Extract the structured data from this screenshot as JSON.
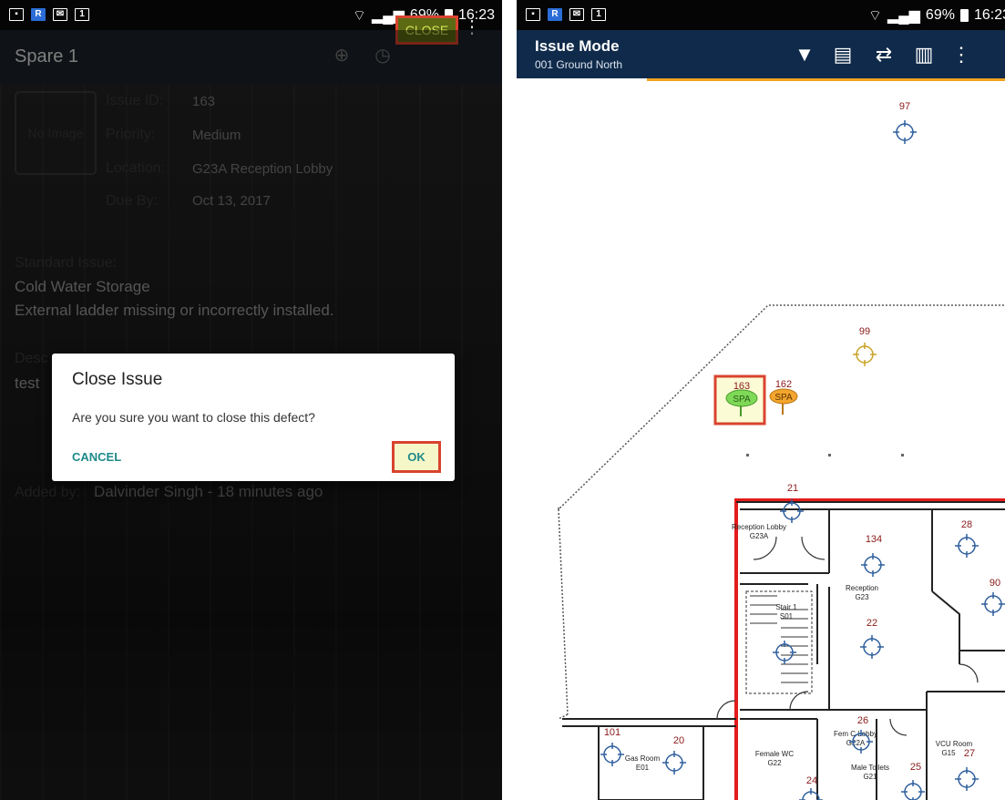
{
  "left": {
    "status": {
      "percent": "69%",
      "time": "16:23"
    },
    "appbar": {
      "title": "Spare 1",
      "close_label": "CLOSE"
    },
    "no_image": "No Image",
    "fields": [
      {
        "label": "Issue ID:",
        "value": "163"
      },
      {
        "label": "Priority:",
        "value": "Medium"
      },
      {
        "label": "Location:",
        "value": "G23A Reception Lobby"
      },
      {
        "label": "Due By:",
        "value": "Oct 13, 2017"
      }
    ],
    "standard_issue_label": "Standard Issue:",
    "standard_issue_line1": "Cold Water Storage",
    "standard_issue_line2": "External ladder missing or incorrectly installed.",
    "description_label": "Desc",
    "description_value": "test",
    "added_by_label": "Added by:",
    "added_by_value": "Dalvinder Singh - 18 minutes ago",
    "dialog": {
      "title": "Close Issue",
      "message": "Are you sure you want to close this defect?",
      "cancel": "CANCEL",
      "ok": "OK"
    }
  },
  "right": {
    "status": {
      "percent": "69%",
      "time": "16:23"
    },
    "appbar": {
      "title": "Issue Mode",
      "subtitle": "001 Ground North"
    },
    "markers": [
      "97",
      "99",
      "163",
      "162",
      "21",
      "134",
      "28",
      "90",
      "22",
      "26",
      "101",
      "20",
      "24",
      "25",
      "27"
    ],
    "pin_label": "SPA",
    "rooms": {
      "reception_lobby": "Reception Lobby",
      "reception_lobby_code": "G23A",
      "reception": "Reception",
      "reception_code": "G23",
      "stair": "Stair 1",
      "stair_code": "S01",
      "gas_room": "Gas Room",
      "gas_room_code": "E01",
      "female_wc": "Female WC",
      "female_wc_code": "G22",
      "fem_lobby": "Fem   C Lobby",
      "fem_lobby_code": "G22A",
      "male_toilets": "Male Toilets",
      "male_toilets_code": "G21",
      "vcu_room": "VCU Room",
      "vcu_room_code": "G15"
    },
    "colors": {
      "appbar": "#0f2a4a",
      "accent": "#f0a321",
      "highlight": "#d9432f",
      "wall": "#e31b1b"
    }
  }
}
